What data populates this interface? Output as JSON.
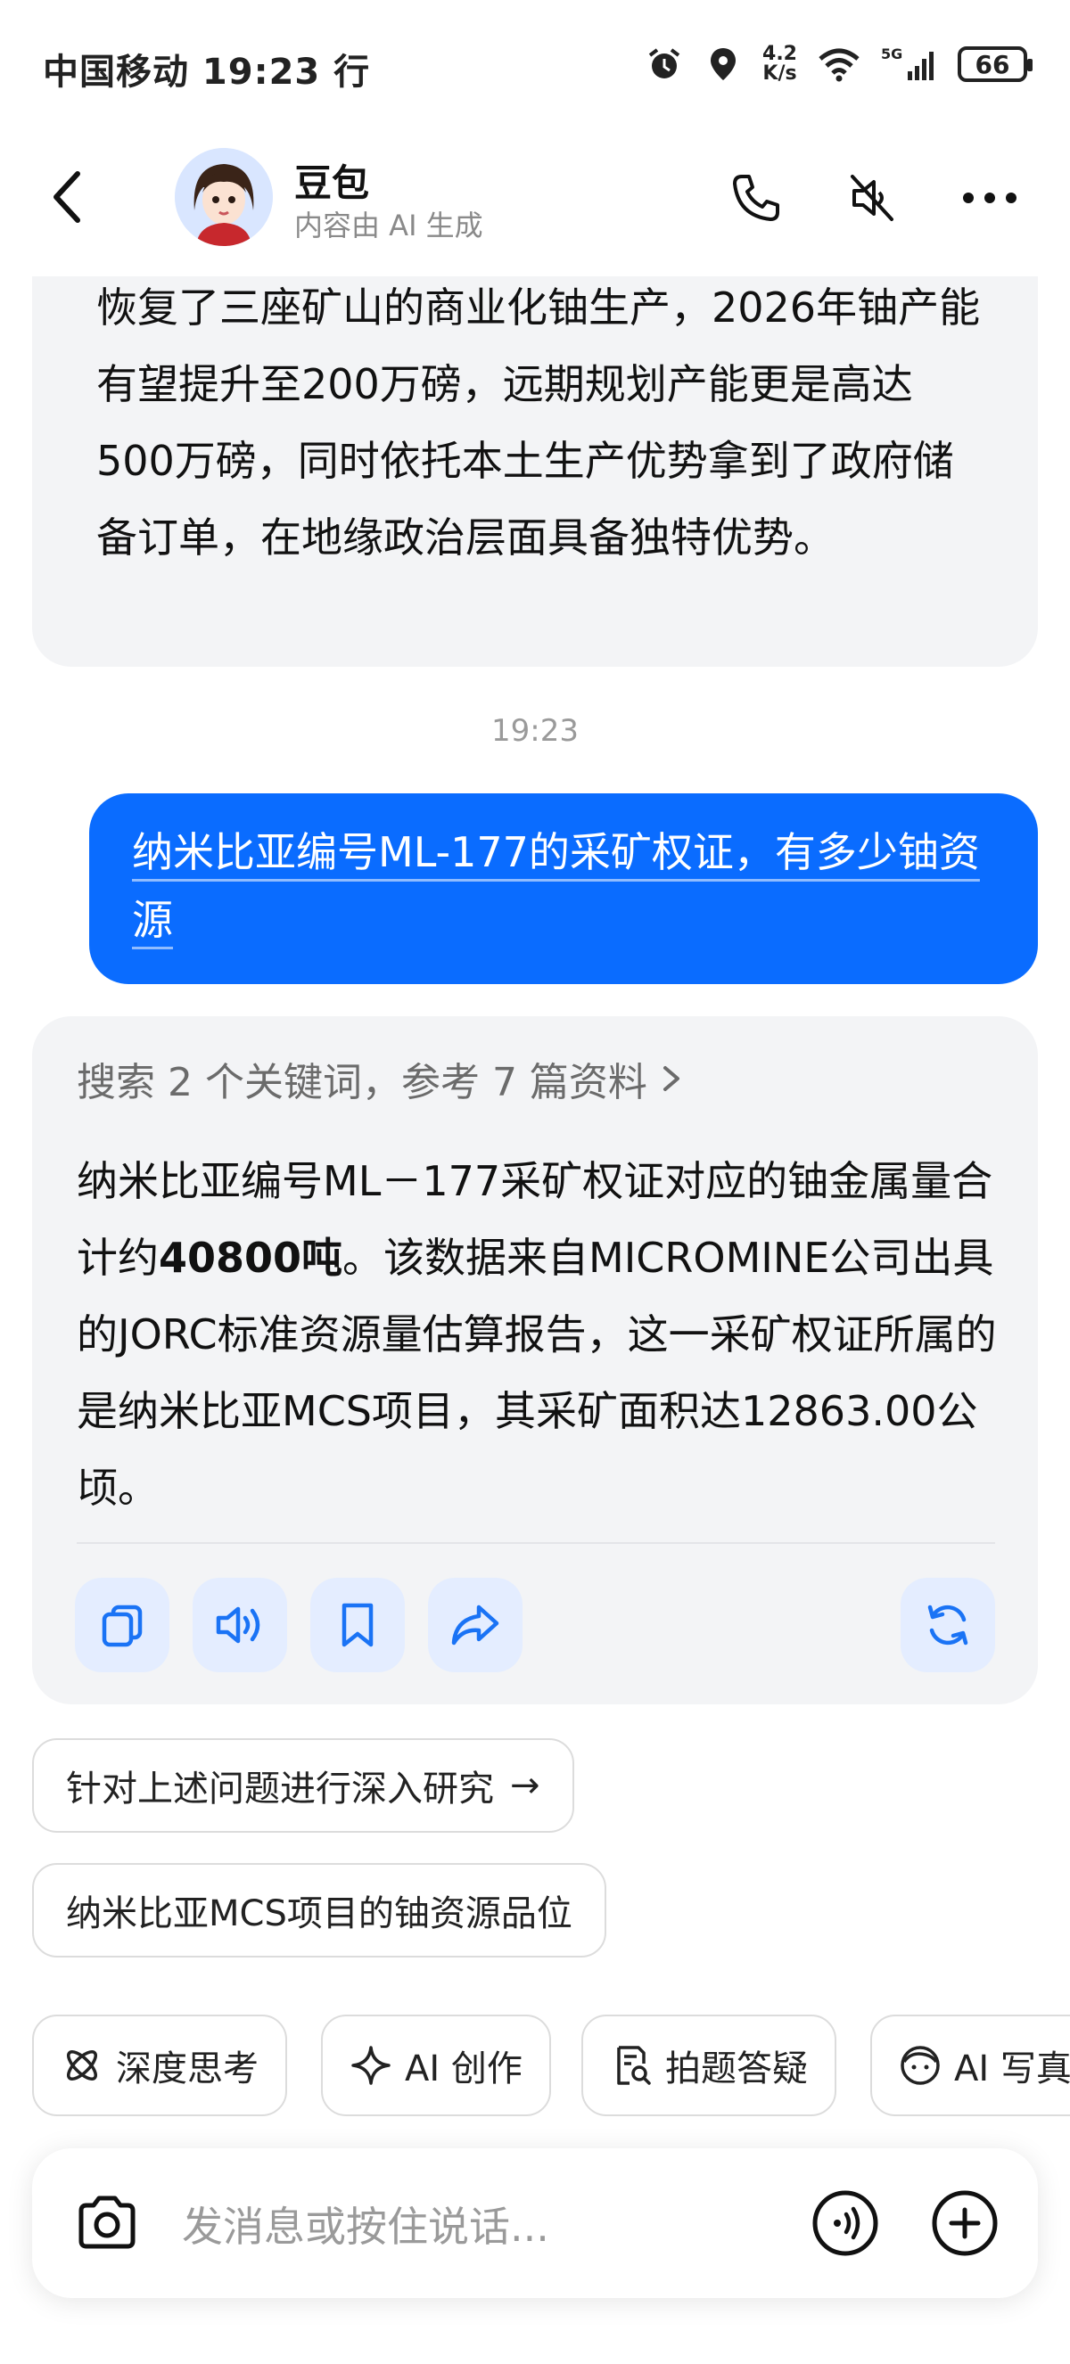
{
  "status_bar": {
    "carrier_time": "中国移动 19:23 行",
    "net_speed_value": "4.2",
    "net_speed_unit": "K/s",
    "network": "5G",
    "battery": "66",
    "icons": [
      "alarm-icon",
      "location-icon",
      "wifi-icon",
      "signal-icon",
      "battery-icon"
    ]
  },
  "header": {
    "bot_name": "豆包",
    "subtitle": "内容由 AI 生成",
    "icons": [
      "back-icon",
      "phone-icon",
      "mute-icon",
      "more-icon"
    ]
  },
  "messages": {
    "prev_ai_text": "恢复了三座矿山的商业化铀生产，2026年铀产能有望提升至200万磅，远期规划产能更是高达500万磅，同时依托本土生产优势拿到了政府储备订单，在地缘政治层面具备独特优势。",
    "timestamp": "19:23",
    "user_text": "纳米比亚编号ML-177的采矿权证，有多少铀资源",
    "search_ref": "搜索 2 个关键词，参考 7 篇资料",
    "answer_part1": "纳米比亚编号ML－177采矿权证对应的铀金属量合计约",
    "answer_bold": "40800吨",
    "answer_part2": "。该数据来自MICROMINE公司出具的JORC标准资源量估算报告，这一采矿权证所属的是纳米比亚MCS项目，其采矿面积达12863.00公顷。"
  },
  "actions": [
    "copy-icon",
    "speaker-icon",
    "bookmark-icon",
    "share-icon",
    "regenerate-icon"
  ],
  "suggestions": [
    {
      "label": "针对上述问题进行深入研究",
      "arrow": "→"
    },
    {
      "label": "纳米比亚MCS项目的铀资源品位",
      "arrow": ""
    }
  ],
  "tools": [
    {
      "label": "深度思考",
      "icon": "atom-icon"
    },
    {
      "label": "AI 创作",
      "icon": "sparkle-icon"
    },
    {
      "label": "拍题答疑",
      "icon": "scan-doc-icon"
    },
    {
      "label": "AI 写真",
      "icon": "face-icon"
    }
  ],
  "input": {
    "placeholder": "发消息或按住说话..."
  },
  "colors": {
    "user_bubble": "#0a6cff",
    "ai_bubble": "#f3f4f6",
    "action_bg": "#e4edff",
    "action_icon": "#1a73f5"
  }
}
